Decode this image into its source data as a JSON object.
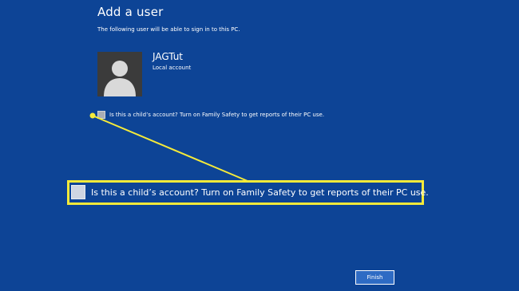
{
  "page": {
    "title": "Add a user",
    "subtitle": "The following user will be able to sign in to this PC."
  },
  "user": {
    "name": "JAGTut",
    "account_type": "Local account",
    "avatar_icon": "user-silhouette-icon"
  },
  "options": {
    "child_account_label": "Is this a child’s account? Turn on Family Safety to get reports of their PC use.",
    "child_account_checked": false
  },
  "callout": {
    "label": "Is this a child’s account? Turn on Family Safety to get reports of their PC use.",
    "highlight_color": "#f5ea3a"
  },
  "buttons": {
    "finish_label": "Finish"
  },
  "colors": {
    "background": "#0d4496",
    "accent_button": "#2e6bc4",
    "highlight": "#f5ea3a"
  }
}
